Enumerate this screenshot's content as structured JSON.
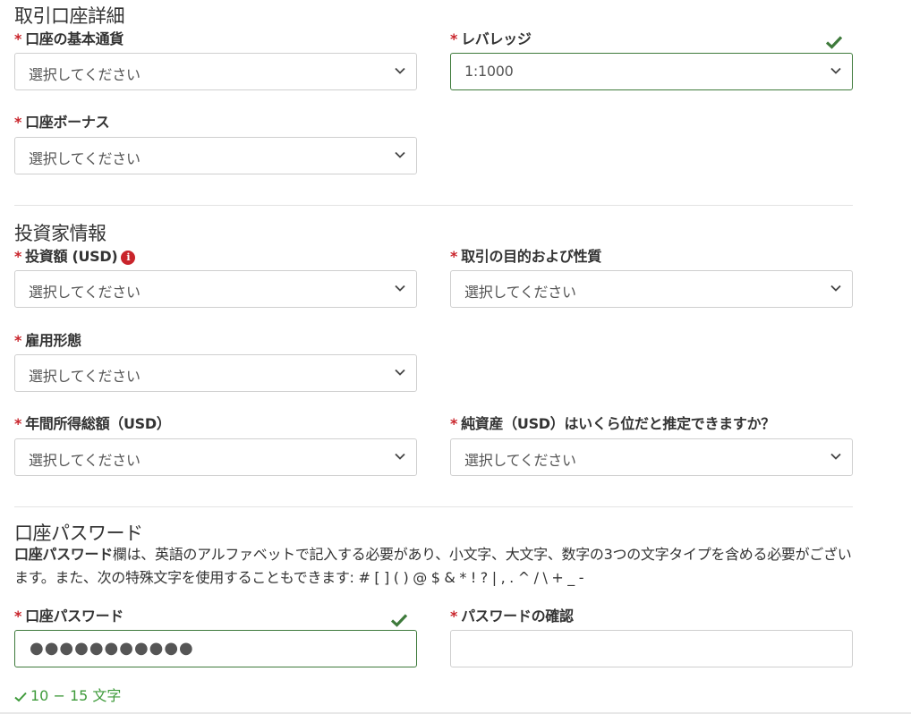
{
  "account_details": {
    "title": "取引口座詳細",
    "base_currency": {
      "label": "口座の基本通貨",
      "value": "選択してください"
    },
    "leverage": {
      "label": "レバレッジ",
      "value": "1:1000"
    },
    "bonus": {
      "label": "口座ボーナス",
      "value": "選択してください"
    }
  },
  "investor_info": {
    "title": "投資家情報",
    "investment_amount": {
      "label": "投資額 (USD)",
      "value": "選択してください",
      "info_glyph": "i"
    },
    "trading_purpose": {
      "label": "取引の目的および性質",
      "value": "選択してください"
    },
    "employment": {
      "label": "雇用形態",
      "value": "選択してください"
    },
    "annual_income": {
      "label": "年間所得総額（USD）",
      "value": "選択してください"
    },
    "net_worth": {
      "label": "純資産（USD）はいくら位だと推定できますか？",
      "value": "選択してください"
    }
  },
  "account_password": {
    "title": "口座パスワード",
    "description_bold": "口座パスワード",
    "description_rest": "欄は、英語のアルファベットで記入する必要があり、小文字、大文字、数字の3つの文字タイプを含める必要がございます。また、次の特殊文字を使用することもできます: # [ ] ( ) @ $ & * ! ? | , . ^ / \\ + _ -",
    "password": {
      "label": "口座パスワード",
      "value": "●●●●●●●●●●●"
    },
    "confirm": {
      "label": "パスワードの確認",
      "value": ""
    },
    "rules": [
      "10 − 15 文字"
    ]
  },
  "required_mark": "*",
  "colors": {
    "required": "#c9242b",
    "valid_border": "#3e7a3b",
    "check": "#3e7a3b",
    "rule_ok": "#3e9a3a"
  }
}
